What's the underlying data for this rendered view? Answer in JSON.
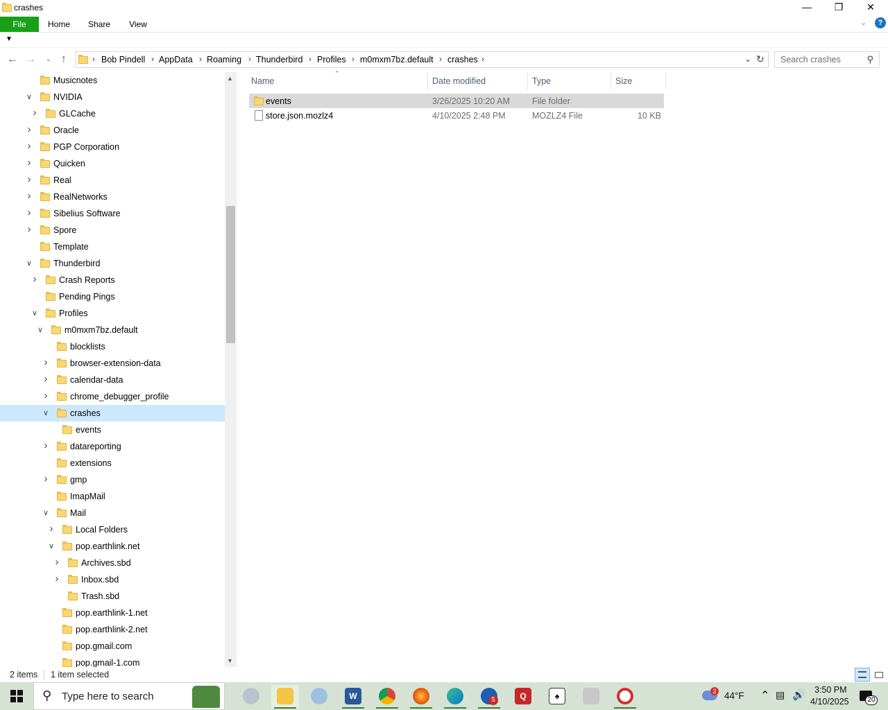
{
  "window": {
    "title": "crashes",
    "minimize": "—",
    "restore": "❐",
    "close": "✕"
  },
  "ribbon": {
    "tabs": [
      "File",
      "Home",
      "Share",
      "View"
    ],
    "help": "?"
  },
  "address": {
    "crumbs": [
      "Bob Pindell",
      "AppData",
      "Roaming",
      "Thunderbird",
      "Profiles",
      "m0mxm7bz.default",
      "crashes"
    ],
    "search_placeholder": "Search crashes"
  },
  "tree": [
    {
      "label": "Musicnotes",
      "level": 0,
      "chevron": "",
      "selected": false
    },
    {
      "label": "NVIDIA",
      "level": 0,
      "chevron": "down",
      "selected": false
    },
    {
      "label": "GLCache",
      "level": 1,
      "chevron": "right",
      "selected": false
    },
    {
      "label": "Oracle",
      "level": 0,
      "chevron": "right",
      "selected": false
    },
    {
      "label": "PGP Corporation",
      "level": 0,
      "chevron": "right",
      "selected": false
    },
    {
      "label": "Quicken",
      "level": 0,
      "chevron": "right",
      "selected": false
    },
    {
      "label": "Real",
      "level": 0,
      "chevron": "right",
      "selected": false
    },
    {
      "label": "RealNetworks",
      "level": 0,
      "chevron": "right",
      "selected": false
    },
    {
      "label": "Sibelius Software",
      "level": 0,
      "chevron": "right",
      "selected": false
    },
    {
      "label": "Spore",
      "level": 0,
      "chevron": "right",
      "selected": false
    },
    {
      "label": "Template",
      "level": 0,
      "chevron": "",
      "selected": false
    },
    {
      "label": "Thunderbird",
      "level": 0,
      "chevron": "down",
      "selected": false
    },
    {
      "label": "Crash Reports",
      "level": 1,
      "chevron": "right",
      "selected": false
    },
    {
      "label": "Pending Pings",
      "level": 1,
      "chevron": "",
      "selected": false
    },
    {
      "label": "Profiles",
      "level": 1,
      "chevron": "down",
      "selected": false
    },
    {
      "label": "m0mxm7bz.default",
      "level": 2,
      "chevron": "down",
      "selected": false
    },
    {
      "label": "blocklists",
      "level": 3,
      "chevron": "",
      "selected": false
    },
    {
      "label": "browser-extension-data",
      "level": 3,
      "chevron": "right",
      "selected": false
    },
    {
      "label": "calendar-data",
      "level": 3,
      "chevron": "right",
      "selected": false
    },
    {
      "label": "chrome_debugger_profile",
      "level": 3,
      "chevron": "right",
      "selected": false
    },
    {
      "label": "crashes",
      "level": 3,
      "chevron": "down",
      "selected": true
    },
    {
      "label": "events",
      "level": 4,
      "chevron": "",
      "selected": false
    },
    {
      "label": "datareporting",
      "level": 3,
      "chevron": "right",
      "selected": false
    },
    {
      "label": "extensions",
      "level": 3,
      "chevron": "",
      "selected": false
    },
    {
      "label": "gmp",
      "level": 3,
      "chevron": "right",
      "selected": false
    },
    {
      "label": "ImapMail",
      "level": 3,
      "chevron": "",
      "selected": false
    },
    {
      "label": "Mail",
      "level": 3,
      "chevron": "down",
      "selected": false
    },
    {
      "label": "Local Folders",
      "level": 4,
      "chevron": "right",
      "selected": false
    },
    {
      "label": "pop.earthlink.net",
      "level": 4,
      "chevron": "down",
      "selected": false
    },
    {
      "label": "Archives.sbd",
      "level": 5,
      "chevron": "right",
      "selected": false
    },
    {
      "label": "Inbox.sbd",
      "level": 5,
      "chevron": "right",
      "selected": false
    },
    {
      "label": "Trash.sbd",
      "level": 5,
      "chevron": "",
      "selected": false
    },
    {
      "label": "pop.earthlink-1.net",
      "level": 4,
      "chevron": "",
      "selected": false
    },
    {
      "label": "pop.earthlink-2.net",
      "level": 4,
      "chevron": "",
      "selected": false
    },
    {
      "label": "pop.gmail.com",
      "level": 4,
      "chevron": "",
      "selected": false
    },
    {
      "label": "pop.gmail-1.com",
      "level": 4,
      "chevron": "",
      "selected": false
    }
  ],
  "columns": {
    "name": "Name",
    "date": "Date modified",
    "type": "Type",
    "size": "Size"
  },
  "files": [
    {
      "name": "events",
      "date": "3/26/2025 10:20 AM",
      "type": "File folder",
      "size": "",
      "kind": "folder",
      "selected": true
    },
    {
      "name": "store.json.mozlz4",
      "date": "4/10/2025 2:48 PM",
      "type": "MOZLZ4 File",
      "size": "10 KB",
      "kind": "file",
      "selected": false
    }
  ],
  "status": {
    "items": "2 items",
    "selected": "1 item selected"
  },
  "taskbar": {
    "search_placeholder": "Type here to search",
    "weather_temp": "44°F",
    "weather_badge": "2",
    "time": "3:50 PM",
    "date": "4/10/2025",
    "notif_count": "20",
    "outlook_badge": "5"
  }
}
